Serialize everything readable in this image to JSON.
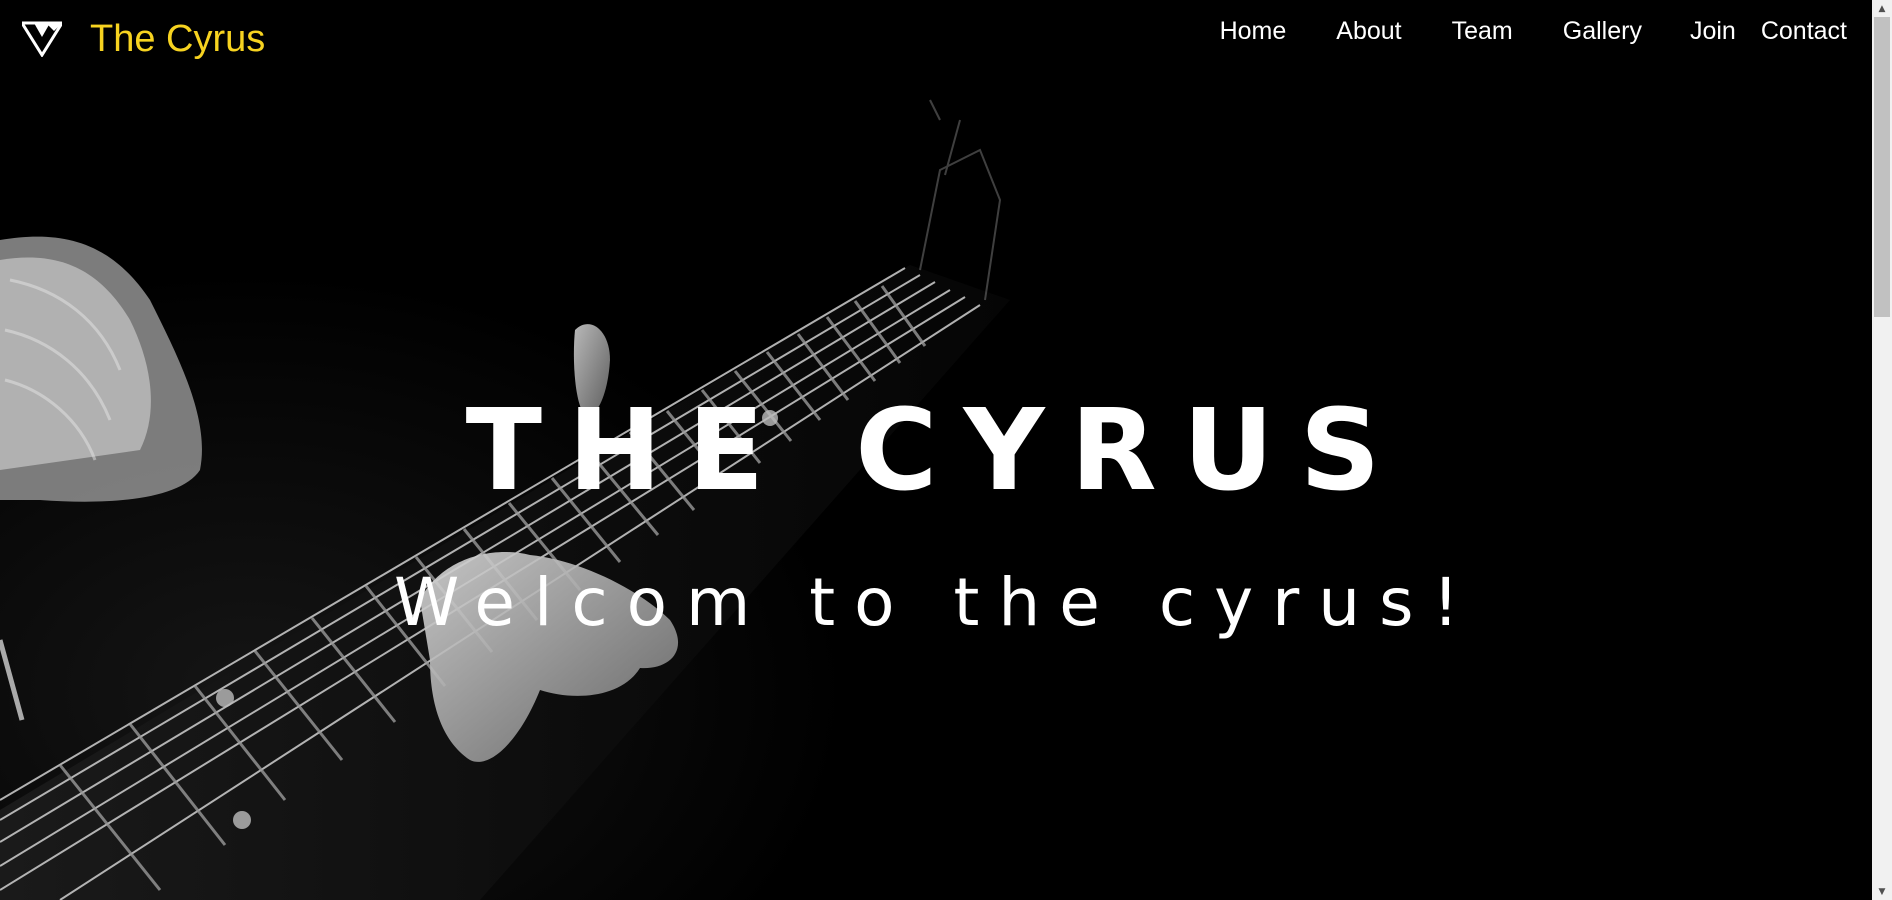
{
  "brand": {
    "name": "The Cyrus",
    "logo_icon": "v-triangle-logo-icon",
    "color": "#f7d320"
  },
  "nav": {
    "items": [
      {
        "label": "Home"
      },
      {
        "label": "About"
      },
      {
        "label": "Team"
      },
      {
        "label": "Gallery"
      },
      {
        "label": "Join"
      },
      {
        "label": "Contact"
      }
    ]
  },
  "hero": {
    "title": "THE CYRUS",
    "subtitle": "Welcom to the cyrus!",
    "background": "guitar-photo-background"
  },
  "scrollbar": {
    "up_icon": "scroll-up-arrow-icon",
    "down_icon": "scroll-down-arrow-icon"
  }
}
